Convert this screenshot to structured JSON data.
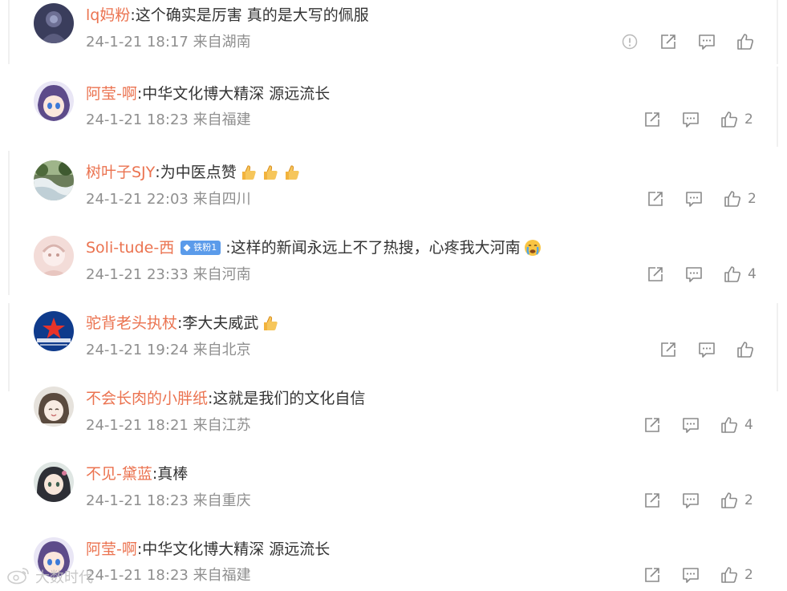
{
  "comments": [
    {
      "username": "lq妈粉",
      "text": "这个确实是厉害 真的是大写的佩服",
      "time": "24-1-21 18:17",
      "location": "来自湖南",
      "likes": "",
      "has_report": true
    },
    {
      "username": "阿莹-啊",
      "text": "中华文化博大精深 源远流长",
      "time": "24-1-21 18:23",
      "location": "来自福建",
      "likes": "2"
    },
    {
      "username": "树叶子SJY",
      "text": "为中医点赞",
      "time": "24-1-21 22:03",
      "location": "来自四川",
      "likes": "2",
      "emoji": "thumbs-up ×3"
    },
    {
      "username": "Soli-tude-西",
      "badge": "铁粉1",
      "text": "这样的新闻永远上不了热搜，心疼我大河南",
      "time": "24-1-21 23:33",
      "location": "来自河南",
      "likes": "4",
      "emoji": "crying-face"
    },
    {
      "username": "驼背老头执杖",
      "text": "李大夫威武",
      "time": "24-1-21 19:24",
      "location": "来自北京",
      "likes": "",
      "emoji": "thumbs-up"
    },
    {
      "username": "不会长肉的小胖纸",
      "text": "这就是我们的文化自信",
      "time": "24-1-21 18:21",
      "location": "来自江苏",
      "likes": "4"
    },
    {
      "username": "不见-黛蓝",
      "text": "真棒",
      "time": "24-1-21 18:23",
      "location": "来自重庆",
      "likes": "2"
    },
    {
      "username": "阿莹-啊",
      "text": "中华文化博大精深 源远流长",
      "time": "24-1-21 18:23",
      "location": "来自福建",
      "likes": "2"
    }
  ],
  "colon": ":",
  "watermark": "大数时代",
  "colors": {
    "username": "#eb7350",
    "text": "#333333",
    "meta": "#8f8f8f",
    "icon": "#8a8a8a",
    "badge": "#5b9bea"
  },
  "icons": {
    "report": "report-icon",
    "forward": "forward-icon",
    "reply": "reply-icon",
    "like": "like-icon"
  }
}
